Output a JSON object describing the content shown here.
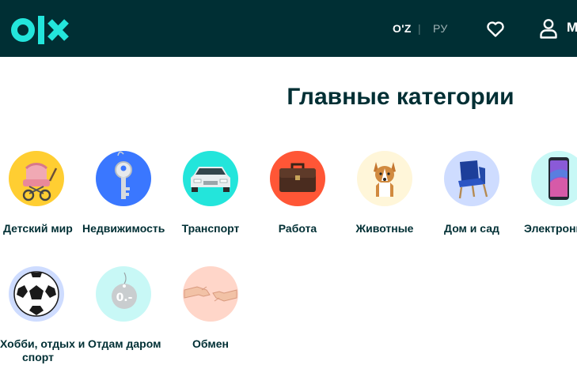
{
  "header": {
    "logo_text": "olx",
    "lang_uz": "O'Z",
    "lang_separator": "|",
    "lang_ru": "РУ",
    "favorites_icon": "heart-icon",
    "profile_icon": "user-icon",
    "profile_label": "М"
  },
  "main": {
    "title": "Главные категории",
    "categories": [
      {
        "label": "Детский мир",
        "icon": "baby-stroller-icon",
        "color": "#ffce32"
      },
      {
        "label": "Недвижимость",
        "icon": "key-icon",
        "color": "#3a77ff"
      },
      {
        "label": "Транспорт",
        "icon": "car-icon",
        "color": "#23e5db"
      },
      {
        "label": "Работа",
        "icon": "briefcase-icon",
        "color": "#ff5636"
      },
      {
        "label": "Животные",
        "icon": "dog-icon",
        "color": "#fff6d9"
      },
      {
        "label": "Дом и сад",
        "icon": "armchair-icon",
        "color": "#cedcff"
      },
      {
        "label": "Электроника",
        "icon": "smartphone-icon",
        "color": "#c8f8f6"
      },
      {
        "label_line1": "Хобби, отдых и",
        "label_line2": "спорт",
        "icon": "soccer-ball-icon",
        "color": "#cedcff"
      },
      {
        "label": "Отдам даром",
        "icon": "price-tag-icon",
        "color": "#c8f8f6"
      },
      {
        "label": "Обмен",
        "icon": "handshake-icon",
        "color": "#ffd6c9"
      }
    ]
  },
  "colors": {
    "header_bg": "#002f34",
    "logo_accent": "#23e5db",
    "text_primary": "#002f34"
  }
}
